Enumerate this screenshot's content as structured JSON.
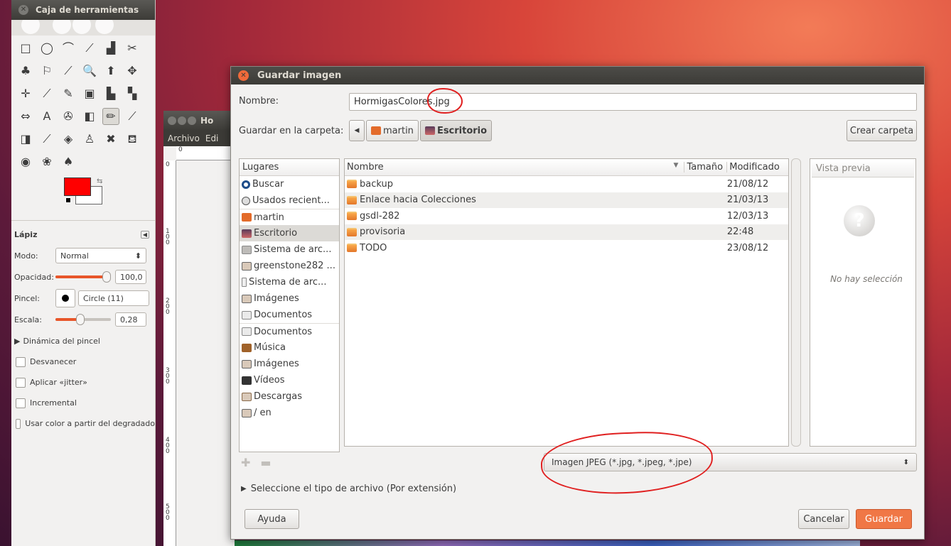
{
  "toolbox": {
    "title": "Caja de herramientas",
    "tools": [
      "□",
      "◯",
      "⌒",
      "⟋",
      "▟",
      "✂",
      "♣",
      "⚐",
      "⟋",
      "🔍",
      "⬆",
      "✥",
      "✛",
      "⟋",
      "✎",
      "▣",
      "▙",
      "▚",
      "⇔",
      "A",
      "✇",
      "◧",
      "✏",
      "⟋",
      "◨",
      "⟋",
      "◈",
      "♙",
      "✖",
      "⛾",
      "◉",
      "❀",
      "♠"
    ],
    "colors": {
      "foreground": "#ff0000",
      "background": "#ffffff"
    },
    "options": {
      "tool_name": "Lápiz",
      "mode_label": "Modo:",
      "mode_value": "Normal",
      "opacity_label": "Opacidad:",
      "opacity_value": "100,0",
      "opacity_fraction": 1.0,
      "brush_label": "Pincel:",
      "brush_value": "Circle (11)",
      "scale_label": "Escala:",
      "scale_value": "0,28",
      "scale_fraction": 0.45,
      "dynamics_label": "Dinámica del pincel",
      "checkboxes": [
        "Desvanecer",
        "Aplicar «jitter»",
        "Incremental",
        "Usar color a partir del degradado"
      ]
    }
  },
  "image_window": {
    "title": "Ho",
    "menu": [
      "Archivo",
      "Edi"
    ],
    "ruler_h": "0",
    "ruler_v": [
      "0",
      "1 0 0",
      "2 0 0",
      "3 0 0",
      "4 0 0",
      "5 0 0"
    ]
  },
  "dialog": {
    "title": "Guardar imagen",
    "name_label": "Nombre:",
    "name_value": "HormigasColores.jpg",
    "folder_label": "Guardar en la carpeta:",
    "path": [
      "martin",
      "Escritorio"
    ],
    "create_folder": "Crear carpeta",
    "places_header": "Lugares",
    "places": [
      {
        "label": "Buscar",
        "icon": "search"
      },
      {
        "label": "Usados recient...",
        "icon": "recent"
      },
      {
        "label": "martin",
        "icon": "home"
      },
      {
        "label": "Escritorio",
        "icon": "desk"
      },
      {
        "label": "Sistema de arc...",
        "icon": "drive"
      },
      {
        "label": "greenstone282 ...",
        "icon": "cam"
      },
      {
        "label": "Sistema de arc...",
        "icon": "usb"
      },
      {
        "label": "Imágenes",
        "icon": "cam"
      },
      {
        "label": "Documentos",
        "icon": "doc"
      },
      {
        "label": "Documentos",
        "icon": "doc"
      },
      {
        "label": "Música",
        "icon": "music"
      },
      {
        "label": "Imágenes",
        "icon": "cam"
      },
      {
        "label": "Vídeos",
        "icon": "video"
      },
      {
        "label": "Descargas",
        "icon": "dl"
      },
      {
        "label": "/ en",
        "icon": "cam"
      }
    ],
    "columns": {
      "name": "Nombre",
      "size": "Tamaño",
      "modified": "Modificado"
    },
    "files": [
      {
        "name": "backup",
        "size": "",
        "modified": "21/08/12"
      },
      {
        "name": "Enlace hacia Colecciones",
        "size": "",
        "modified": "21/03/13"
      },
      {
        "name": "gsdl-282",
        "size": "",
        "modified": "12/03/13"
      },
      {
        "name": "provisoria",
        "size": "",
        "modified": "22:48"
      },
      {
        "name": "TODO",
        "size": "",
        "modified": "23/08/12"
      }
    ],
    "preview_header": "Vista previa",
    "no_selection": "No hay selección",
    "filetype_value": "Imagen JPEG (*.jpg, *.jpeg, *.jpe)",
    "filetype_expander": "Seleccione el tipo de archivo (Por extensión)",
    "help_button": "Ayuda",
    "cancel_button": "Cancelar",
    "save_button": "Guardar",
    "accent_color": "#f07746"
  }
}
